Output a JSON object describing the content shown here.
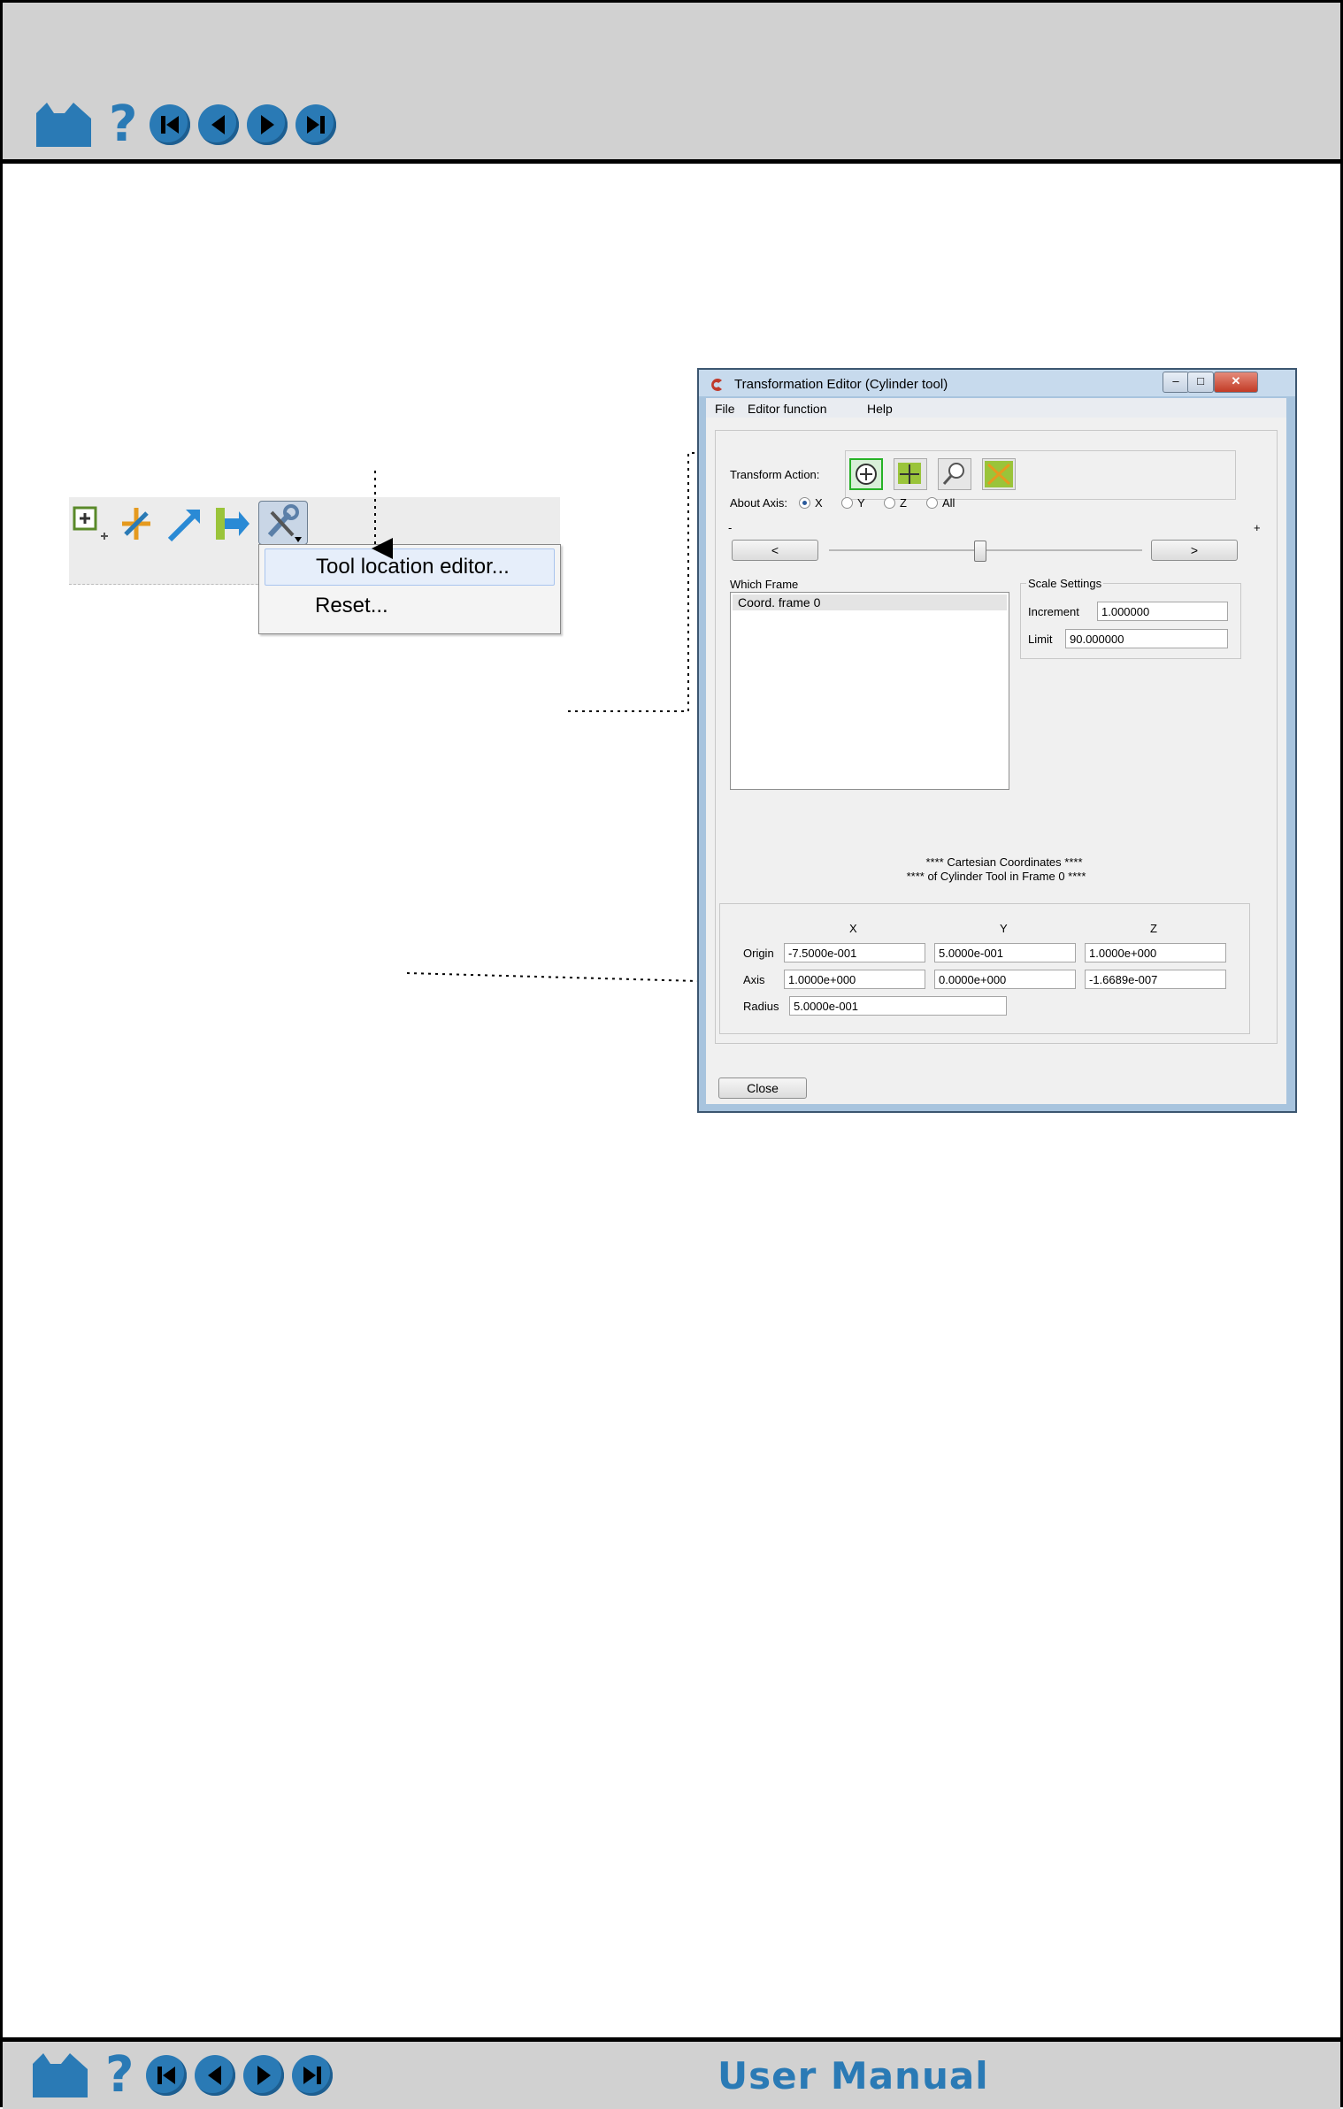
{
  "nav": {
    "home_icon": "home-icon",
    "help_label": "?",
    "buttons": [
      "first-page-icon",
      "prev-page-icon",
      "next-page-icon",
      "last-page-icon"
    ]
  },
  "footer": {
    "title": "User Manual"
  },
  "toolbar_menu": {
    "items": [
      "Tool location editor...",
      "Reset..."
    ]
  },
  "window": {
    "title": "Transformation Editor (Cylinder tool)",
    "menus": [
      "File",
      "Editor function",
      "Help"
    ],
    "transform_action_label": "Transform Action:",
    "about_axis_label": "About Axis:",
    "axis_options": [
      "X",
      "Y",
      "Z",
      "All"
    ],
    "axis_selected": "X",
    "slider_minus": "-",
    "slider_plus": "+",
    "step_left": "<",
    "step_right": ">",
    "which_frame_label": "Which Frame",
    "frames": [
      "Coord. frame 0"
    ],
    "scale_settings": {
      "label": "Scale Settings",
      "increment_label": "Increment",
      "increment_value": "1.000000",
      "limit_label": "Limit",
      "limit_value": "90.000000"
    },
    "coords_header_1": "**** Cartesian Coordinates ****",
    "coords_header_2": "**** of Cylinder Tool in Frame 0 ****",
    "columns": [
      "X",
      "Y",
      "Z"
    ],
    "origin": {
      "label": "Origin",
      "values": [
        "-7.5000e-001",
        "5.0000e-001",
        "1.0000e+000"
      ]
    },
    "axis": {
      "label": "Axis",
      "values": [
        "1.0000e+000",
        "0.0000e+000",
        "-1.6689e-007"
      ]
    },
    "radius": {
      "label": "Radius",
      "value": "5.0000e-001"
    },
    "close_label": "Close"
  }
}
